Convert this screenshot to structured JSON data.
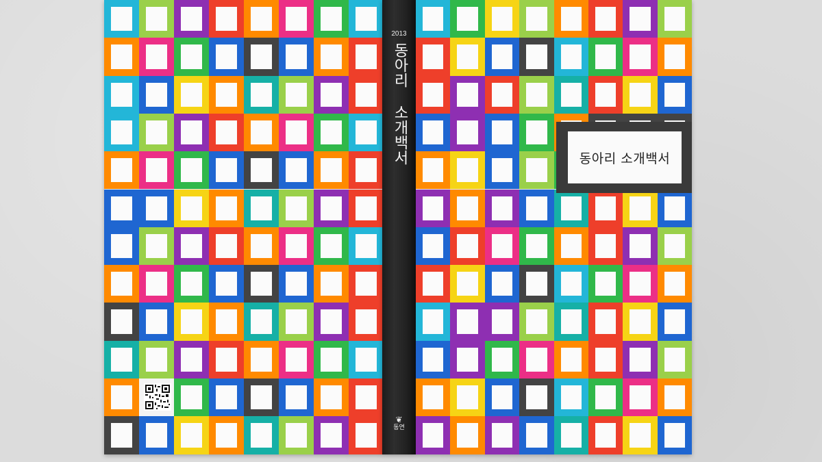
{
  "book": {
    "year": "2013",
    "spine_title": "동아리 소개백서",
    "cover_title": "동아리 소개백서",
    "publisher": "동연",
    "publisher_mark": "❦"
  },
  "palette": {
    "white": "#f4f4f4",
    "pink": "#ec2f86",
    "purple": "#8e2fb2",
    "orange": "#ff8a00",
    "red": "#ee3f2a",
    "yellow": "#f6d415",
    "green": "#30b84a",
    "lime": "#9ad04a",
    "cyan": "#23b6d8",
    "blue": "#1f66d1",
    "teal": "#16b0a6",
    "gray": "#434343"
  },
  "back_grid": [
    [
      "cyan",
      "lime",
      "purple",
      "red",
      "orange",
      "pink",
      "green",
      "cyan"
    ],
    [
      "orange",
      "pink",
      "green",
      "blue",
      "gray",
      "blue",
      "orange",
      "red"
    ],
    [
      "cyan",
      "blue",
      "yellow",
      "orange",
      "teal",
      "lime",
      "purple",
      "red"
    ],
    [
      "cyan",
      "lime",
      "purple",
      "red",
      "orange",
      "pink",
      "green",
      "cyan"
    ],
    [
      "orange",
      "pink",
      "green",
      "blue",
      "gray",
      "blue",
      "orange",
      "red"
    ],
    [
      "blue",
      "blue",
      "yellow",
      "orange",
      "teal",
      "lime",
      "purple",
      "red"
    ],
    [
      "blue",
      "lime",
      "purple",
      "red",
      "orange",
      "pink",
      "green",
      "cyan"
    ],
    [
      "orange",
      "pink",
      "green",
      "blue",
      "gray",
      "blue",
      "orange",
      "red"
    ],
    [
      "gray",
      "blue",
      "yellow",
      "orange",
      "teal",
      "lime",
      "purple",
      "red"
    ],
    [
      "teal",
      "lime",
      "purple",
      "red",
      "orange",
      "pink",
      "green",
      "cyan"
    ],
    [
      "orange",
      "white",
      "green",
      "blue",
      "gray",
      "blue",
      "orange",
      "red"
    ],
    [
      "gray",
      "blue",
      "yellow",
      "orange",
      "teal",
      "lime",
      "purple",
      "red"
    ]
  ],
  "front_grid": [
    [
      "cyan",
      "green",
      "yellow",
      "lime",
      "orange",
      "red",
      "purple",
      "lime",
      "teal"
    ],
    [
      "red",
      "yellow",
      "blue",
      "gray",
      "cyan",
      "green",
      "pink",
      "orange",
      "white"
    ],
    [
      "red",
      "purple",
      "red",
      "lime",
      "teal",
      "red",
      "yellow",
      "blue",
      "white"
    ],
    [
      "blue",
      "purple",
      "blue",
      "green",
      "orange",
      "gray",
      "gray",
      "gray",
      "gray"
    ],
    [
      "orange",
      "yellow",
      "blue",
      "lime",
      "green",
      "gray",
      "gray",
      "gray",
      "gray"
    ],
    [
      "purple",
      "orange",
      "purple",
      "blue",
      "teal",
      "red",
      "yellow",
      "blue",
      "white"
    ],
    [
      "blue",
      "red",
      "pink",
      "green",
      "orange",
      "red",
      "purple",
      "lime",
      "teal"
    ],
    [
      "red",
      "yellow",
      "blue",
      "gray",
      "cyan",
      "green",
      "pink",
      "orange",
      "white"
    ],
    [
      "cyan",
      "purple",
      "purple",
      "lime",
      "teal",
      "red",
      "yellow",
      "blue",
      "white"
    ],
    [
      "blue",
      "purple",
      "green",
      "pink",
      "orange",
      "red",
      "purple",
      "lime",
      "teal"
    ],
    [
      "orange",
      "yellow",
      "blue",
      "gray",
      "cyan",
      "green",
      "pink",
      "orange",
      "white"
    ],
    [
      "purple",
      "orange",
      "purple",
      "blue",
      "teal",
      "red",
      "yellow",
      "blue",
      "white"
    ]
  ]
}
